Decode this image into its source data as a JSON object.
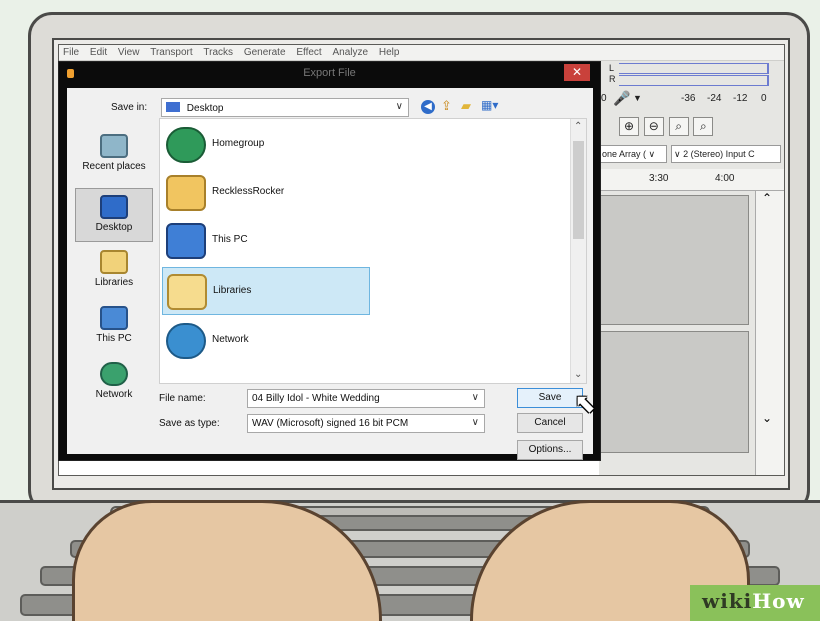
{
  "menubar": [
    "File",
    "Edit",
    "View",
    "Transport",
    "Tracks",
    "Generate",
    "Effect",
    "Analyze",
    "Help"
  ],
  "right_panel": {
    "meter_l": "L",
    "meter_r": "R",
    "scale": [
      "0",
      "-36",
      "-24",
      "-12",
      "0"
    ],
    "device_left": "one Array (",
    "device_right": "2 (Stereo) Input C",
    "timeline": [
      "3:30",
      "4:00"
    ]
  },
  "dialog": {
    "title": "Export File",
    "close": "✕",
    "save_in_label": "Save in:",
    "save_in_value": "Desktop",
    "places": [
      {
        "label": "Recent places",
        "icon": "recent-places-icon"
      },
      {
        "label": "Desktop",
        "icon": "desktop-icon"
      },
      {
        "label": "Libraries",
        "icon": "libraries-icon"
      },
      {
        "label": "This PC",
        "icon": "this-pc-icon"
      },
      {
        "label": "Network",
        "icon": "network-icon"
      }
    ],
    "items": [
      {
        "label": "Homegroup",
        "icon": "homegroup-icon"
      },
      {
        "label": "RecklessRocker",
        "icon": "user-folder-icon"
      },
      {
        "label": "This PC",
        "icon": "computer-icon"
      },
      {
        "label": "Libraries",
        "icon": "libraries-folder-icon"
      },
      {
        "label": "Network",
        "icon": "network-globe-icon"
      }
    ],
    "file_name_label": "File name:",
    "file_name_value": "04 Billy Idol - White Wedding",
    "save_as_type_label": "Save as type:",
    "save_as_type_value": "WAV (Microsoft) signed 16 bit PCM",
    "save_button": "Save",
    "cancel_button": "Cancel",
    "options_button": "Options..."
  },
  "watermark": {
    "part1": "wiki",
    "part2": "How"
  },
  "colors": {
    "selection": "#cde8f6",
    "close": "#c9413b",
    "accent_blue": "#3f6fd1"
  }
}
